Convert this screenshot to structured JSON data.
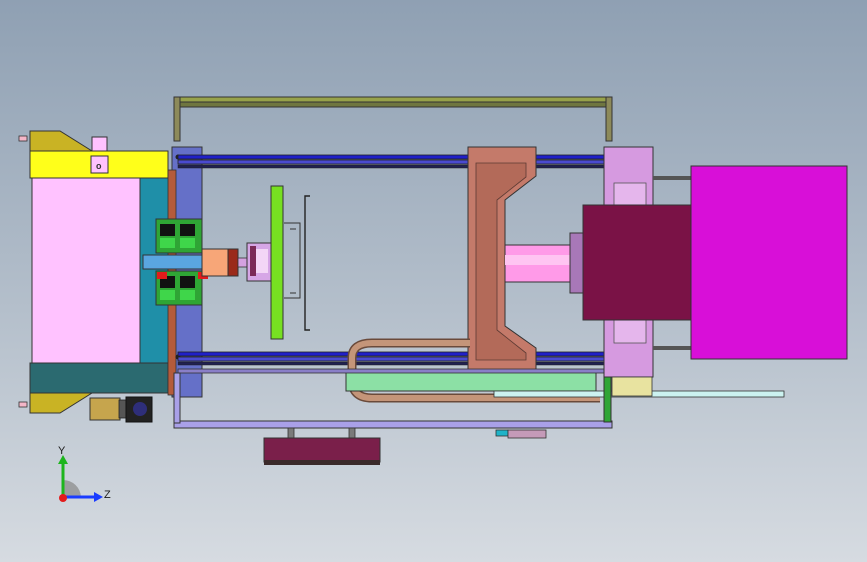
{
  "view": {
    "triad": {
      "y_label": "Y",
      "z_label": "Z",
      "y_color": "#1db51d",
      "z_color": "#1a3cff",
      "origin_color": "#e21b1b"
    },
    "part_mark": "o"
  },
  "colors": {
    "background_top": "#8fa0b3",
    "background_bottom": "#d6dbe1",
    "motor_block": "#d80fd8",
    "piston": "#7a1246",
    "platen": "#c47a6a",
    "pink_panel": "#ffc2ff",
    "yellow_bar": "#ffff1a",
    "teal_block": "#1f8fa8",
    "green_plate": "#77e021",
    "rail_blue": "#2020c8",
    "frame": "#a9a0e8",
    "cylinder_lilac": "#d69ae0"
  }
}
